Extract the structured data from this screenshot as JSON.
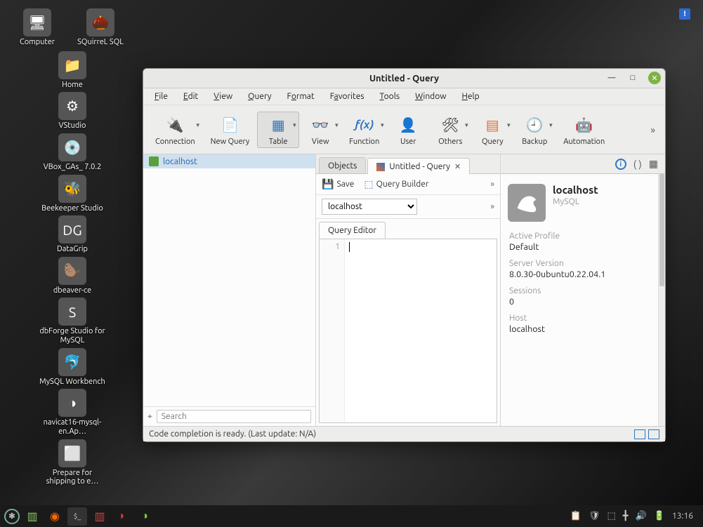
{
  "desktop_icons": [
    {
      "label": "Computer",
      "glyph": "🖥"
    },
    {
      "label": "SQuirreL SQL",
      "glyph": "🌰"
    },
    {
      "label": "Home",
      "glyph": "📁"
    },
    {
      "label": "VStudio",
      "glyph": "⚙"
    },
    {
      "label": "VBox_GAs_\n7.0.2",
      "glyph": "💿"
    },
    {
      "label": "",
      "glyph": ""
    },
    {
      "label": "Beekeeper Studio",
      "glyph": "🐝"
    },
    {
      "label": "",
      "glyph": ""
    },
    {
      "label": "DataGrip",
      "glyph": "DG"
    },
    {
      "label": "",
      "glyph": ""
    },
    {
      "label": "dbeaver-ce",
      "glyph": "🦫"
    },
    {
      "label": "",
      "glyph": ""
    },
    {
      "label": "dbForge Studio for MySQL",
      "glyph": "S"
    },
    {
      "label": "",
      "glyph": ""
    },
    {
      "label": "MySQL Workbench",
      "glyph": "🐬"
    },
    {
      "label": "",
      "glyph": ""
    },
    {
      "label": "navicat16-mysql-en.Ap…",
      "glyph": "◑"
    },
    {
      "label": "",
      "glyph": ""
    },
    {
      "label": "Prepare for shipping to e…",
      "glyph": "⬜"
    }
  ],
  "notif_badge": "!",
  "window": {
    "title": "Untitled - Query",
    "menus": [
      "File",
      "Edit",
      "View",
      "Query",
      "Format",
      "Favorites",
      "Tools",
      "Window",
      "Help"
    ],
    "menu_accel": [
      "F",
      "E",
      "V",
      "Q",
      "o",
      "a",
      "T",
      "W",
      "H"
    ],
    "toolbar": [
      {
        "label": "Connection",
        "dd": true,
        "glyph": "🔌"
      },
      {
        "label": "New Query",
        "dd": false,
        "glyph": "📄"
      },
      {
        "label": "Table",
        "dd": true,
        "glyph": "▦",
        "active": true
      },
      {
        "label": "View",
        "dd": true,
        "glyph": "👓"
      },
      {
        "label": "Function",
        "dd": true,
        "glyph": "ƒ(x)"
      },
      {
        "label": "User",
        "dd": false,
        "glyph": "👤"
      },
      {
        "label": "Others",
        "dd": true,
        "glyph": "🛠"
      },
      {
        "label": "Query",
        "dd": true,
        "glyph": "▤"
      },
      {
        "label": "Backup",
        "dd": true,
        "glyph": "🕘"
      },
      {
        "label": "Automation",
        "dd": false,
        "glyph": "🤖"
      }
    ],
    "left": {
      "connection_label": "localhost",
      "search_placeholder": "Search"
    },
    "center": {
      "tabs": [
        {
          "label": "Objects",
          "active": false,
          "closable": false
        },
        {
          "label": "Untitled - Query",
          "active": true,
          "closable": true
        }
      ],
      "subbar": {
        "save": "Save",
        "qb": "Query Builder"
      },
      "conn_selector": "localhost",
      "editor_tab": "Query Editor",
      "line_number": "1"
    },
    "right": {
      "title": "localhost",
      "subtitle": "MySQL",
      "fields": [
        {
          "label": "Active Profile",
          "value": "Default"
        },
        {
          "label": "Server Version",
          "value": "8.0.30-0ubuntu0.22.04.1"
        },
        {
          "label": "Sessions",
          "value": "0"
        },
        {
          "label": "Host",
          "value": "localhost"
        }
      ]
    },
    "status": "Code completion is ready. (Last update: N/A)"
  },
  "taskbar_clock": "13:16"
}
